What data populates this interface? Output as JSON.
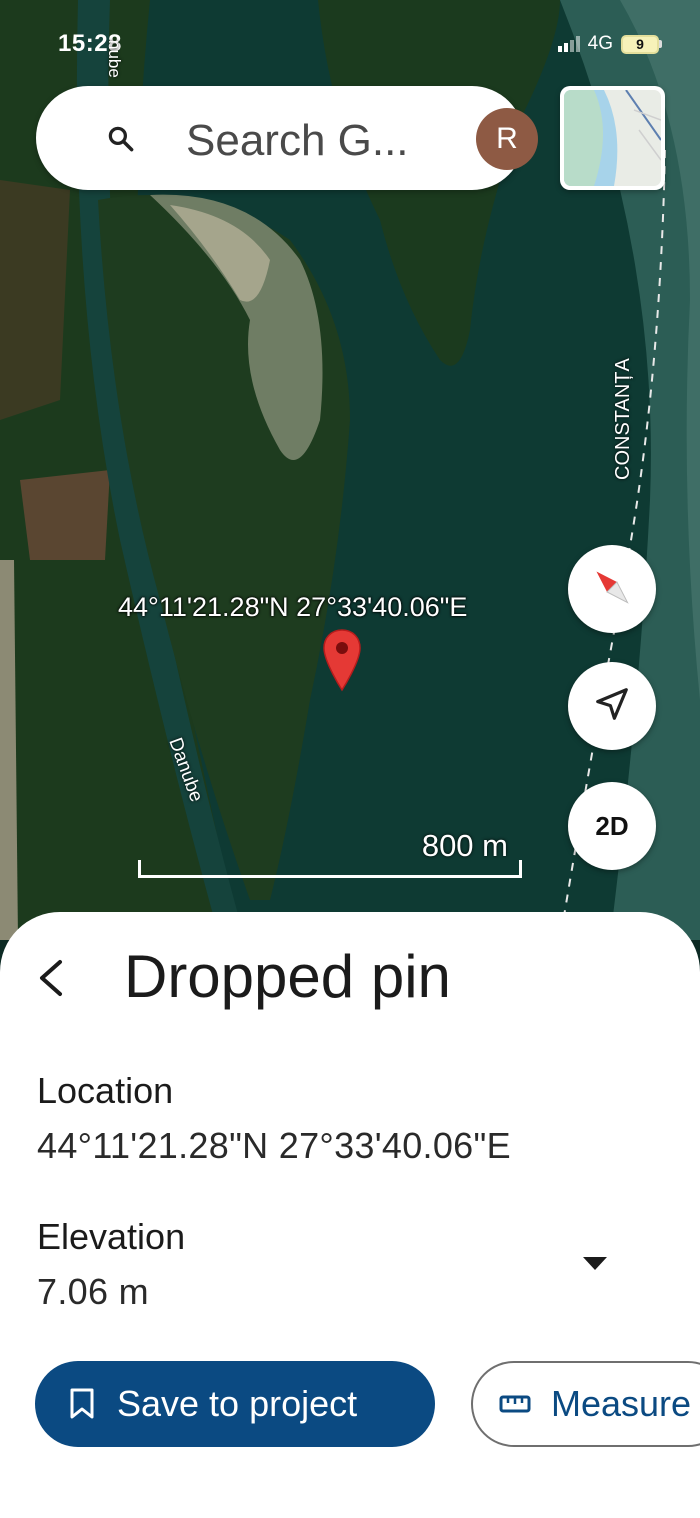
{
  "status_bar": {
    "time": "15:28",
    "network": "4G",
    "battery": "9"
  },
  "search": {
    "placeholder": "Search G..."
  },
  "avatar": {
    "initial": "R"
  },
  "map": {
    "coordinates_label": "44°11'21.28\"N 27°33'40.06\"E",
    "river_label": "Danube",
    "road_label": "CONSTANȚA",
    "edge_label": "nube",
    "mode_button": "2D",
    "scale": "800 m",
    "icons": [
      "compass-icon",
      "my-location-icon",
      "search-icon",
      "layers-thumbnail",
      "map-pin-icon"
    ]
  },
  "sheet": {
    "title": "Dropped pin",
    "location_label": "Location",
    "location_value": "44°11'21.28\"N 27°33'40.06\"E",
    "elevation_label": "Elevation",
    "elevation_value": "7.06 m",
    "save_button": "Save to project",
    "measure_button": "Measure"
  },
  "colors": {
    "accent": "#0b4a82",
    "pin": "#e53935",
    "avatar": "#8e5a44"
  }
}
